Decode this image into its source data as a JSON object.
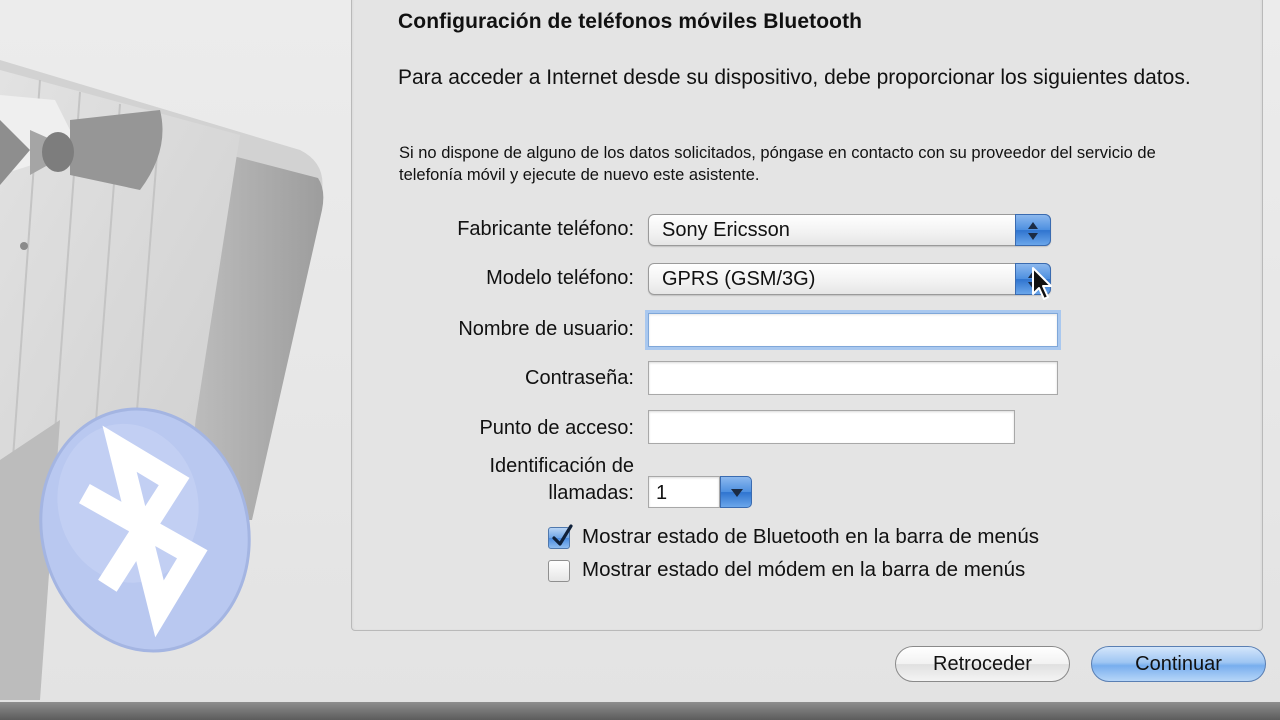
{
  "title": "Configuración de teléfonos móviles Bluetooth",
  "intro": "Para acceder a Internet desde su dispositivo, debe proporcionar los siguientes datos.",
  "note": "Si no dispone de alguno de los datos solicitados, póngase en contacto con su proveedor del servicio de telefonía móvil y ejecute de nuevo este asistente.",
  "form": {
    "manufacturer": {
      "label": "Fabricante teléfono:",
      "value": "Sony Ericsson"
    },
    "model": {
      "label": "Modelo teléfono:",
      "value": "GPRS (GSM/3G)"
    },
    "username": {
      "label": "Nombre de usuario:",
      "value": ""
    },
    "password": {
      "label": "Contraseña:",
      "value": ""
    },
    "access_point": {
      "label": "Punto de acceso:",
      "value": ""
    },
    "caller_id": {
      "label_line1": "Identificación de",
      "label_line2": "llamadas:",
      "value": "1"
    }
  },
  "checkboxes": [
    {
      "label": "Mostrar estado de Bluetooth en la barra de menús",
      "checked": true
    },
    {
      "label": "Mostrar estado del módem en la barra de menús",
      "checked": false
    }
  ],
  "buttons": {
    "back": "Retroceder",
    "continue": "Continuar"
  },
  "icons": {
    "illustration": "tuxedo-bluetooth-illustration",
    "popup_stepper": "updown-arrows-icon",
    "combo_arrow": "chevron-down-icon",
    "checkmark": "checkmark-icon",
    "pointer": "mouse-pointer-icon"
  },
  "colors": {
    "accent": "#4d8fe0",
    "focus_ring": "#a9c8ef",
    "bluetooth_badge": "#b9c8f0"
  }
}
